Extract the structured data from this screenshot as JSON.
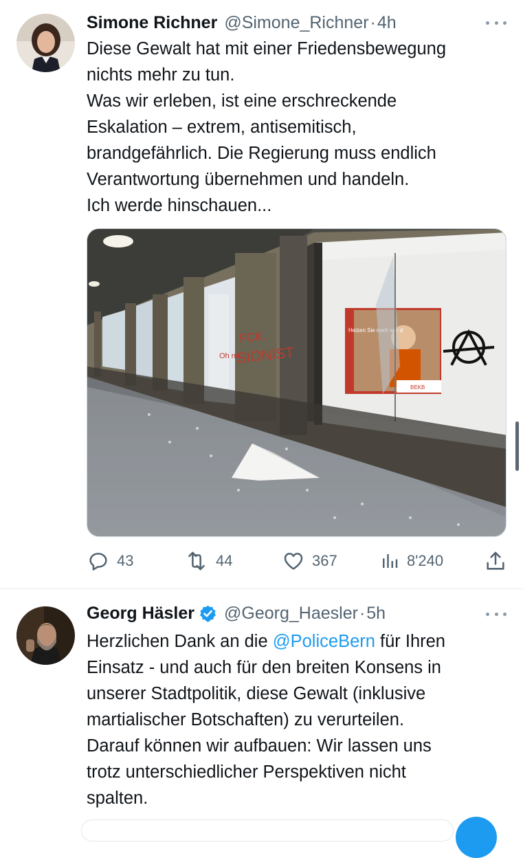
{
  "tweets": [
    {
      "author_name": "Simone Richner",
      "handle": "@Simone_Richner",
      "separator": "·",
      "time": "4h",
      "verified": false,
      "text_lines": [
        "Diese Gewalt hat mit einer Friedensbewegung",
        "nichts mehr zu tun.",
        "Was wir erleben, ist eine erschreckende",
        "Eskalation – extrem, antisemitisch,",
        "brandgefährlich. Die Regierung muss endlich",
        "Verantwortung übernehmen und handeln.",
        "Ich werde hinschauen..."
      ],
      "media": {
        "graffiti_text_1": "FCK.",
        "graffiti_text_2": "SIONIST",
        "graffiti_text_3": "Oh no",
        "poster_text": "Heizen Sie noch wie d",
        "bank_logo": "BEKB"
      },
      "stats": {
        "replies": "43",
        "retweets": "44",
        "likes": "367",
        "views": "8'240"
      }
    },
    {
      "author_name": "Georg Häsler",
      "handle": "@Georg_Haesler",
      "separator": "·",
      "time": "5h",
      "verified": true,
      "text_line_1_before": "Herzlichen Dank an die ",
      "text_line_1_mention": "@PoliceBern",
      "text_line_1_after": " für Ihren",
      "text_lines": [
        "Einsatz - und auch für den breiten Konsens in",
        "unserer Stadtpolitik, diese Gewalt (inklusive",
        "martialischer Botschaften) zu verurteilen.",
        "Darauf können wir aufbauen: Wir lassen uns",
        "trotz unterschiedlicher Perspektiven nicht",
        "spalten."
      ]
    }
  ],
  "colors": {
    "text": "#0f1419",
    "secondary": "#536471",
    "accent": "#1d9bf0",
    "divider": "#e7ecf0"
  },
  "icons": [
    "reply-icon",
    "retweet-icon",
    "like-icon",
    "views-icon",
    "share-icon",
    "more-icon",
    "verified-badge-icon"
  ]
}
